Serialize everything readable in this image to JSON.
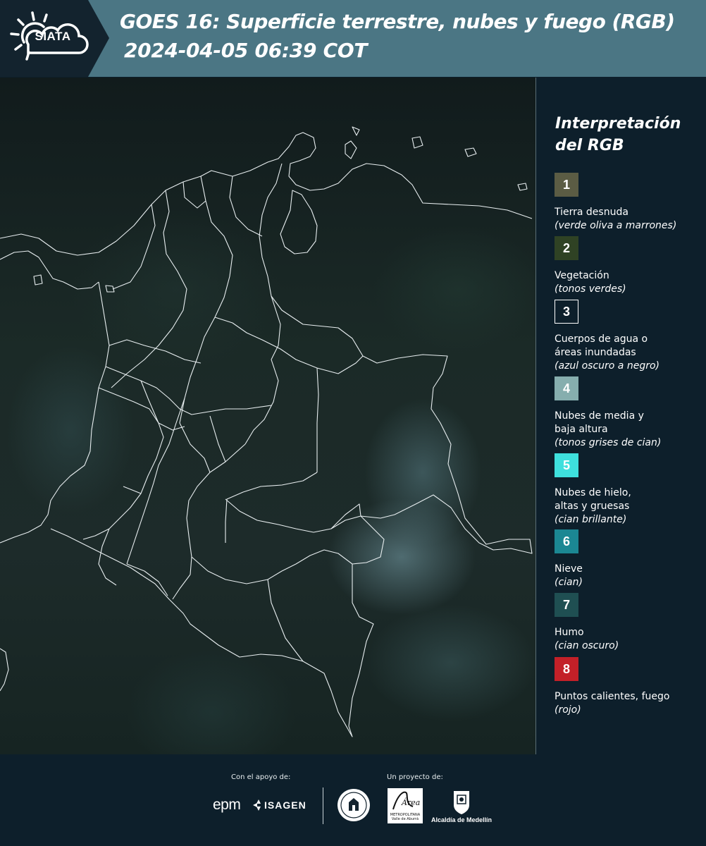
{
  "header": {
    "logo_text": "SIATA",
    "title_line1": "GOES 16: Superficie terrestre, nubes y fuego (RGB)",
    "title_line2": "2024-04-05 06:39 COT"
  },
  "legend": {
    "title": "Interpretación del RGB",
    "items": [
      {
        "number": "1",
        "label": "Tierra desnuda",
        "sub": "(verde oliva a marrones)",
        "color": "#5b5c44"
      },
      {
        "number": "2",
        "label": "Vegetación",
        "sub": "(tonos verdes)",
        "color": "#2f4224"
      },
      {
        "number": "3",
        "label": "Cuerpos de agua o áreas inundadas",
        "sub": "(azul oscuro a negro)",
        "color": "#0d1f2b"
      },
      {
        "number": "4",
        "label": "Nubes de media y baja altura",
        "sub": "(tonos grises de cian)",
        "color": "#86aeae"
      },
      {
        "number": "5",
        "label": "Nubes de hielo, altas y gruesas",
        "sub": "(cian brillante)",
        "color": "#3ee0dd"
      },
      {
        "number": "6",
        "label": "Nieve",
        "sub": "(cian)",
        "color": "#1b8793"
      },
      {
        "number": "7",
        "label": "Humo",
        "sub": "(cian oscuro)",
        "color": "#1f4f52"
      },
      {
        "number": "8",
        "label": "Puntos calientes, fuego",
        "sub": "(rojo)",
        "color": "#c32028"
      }
    ]
  },
  "footer": {
    "support_label": "Con el apoyo de:",
    "project_label": "Un proyecto de:",
    "epm": "epm",
    "isagen": "ISAGEN",
    "amva_text": "METROPOLITANA Valle de Aburrá",
    "amva_mark": "Área",
    "medellin": "Alcaldía de Medellín"
  }
}
